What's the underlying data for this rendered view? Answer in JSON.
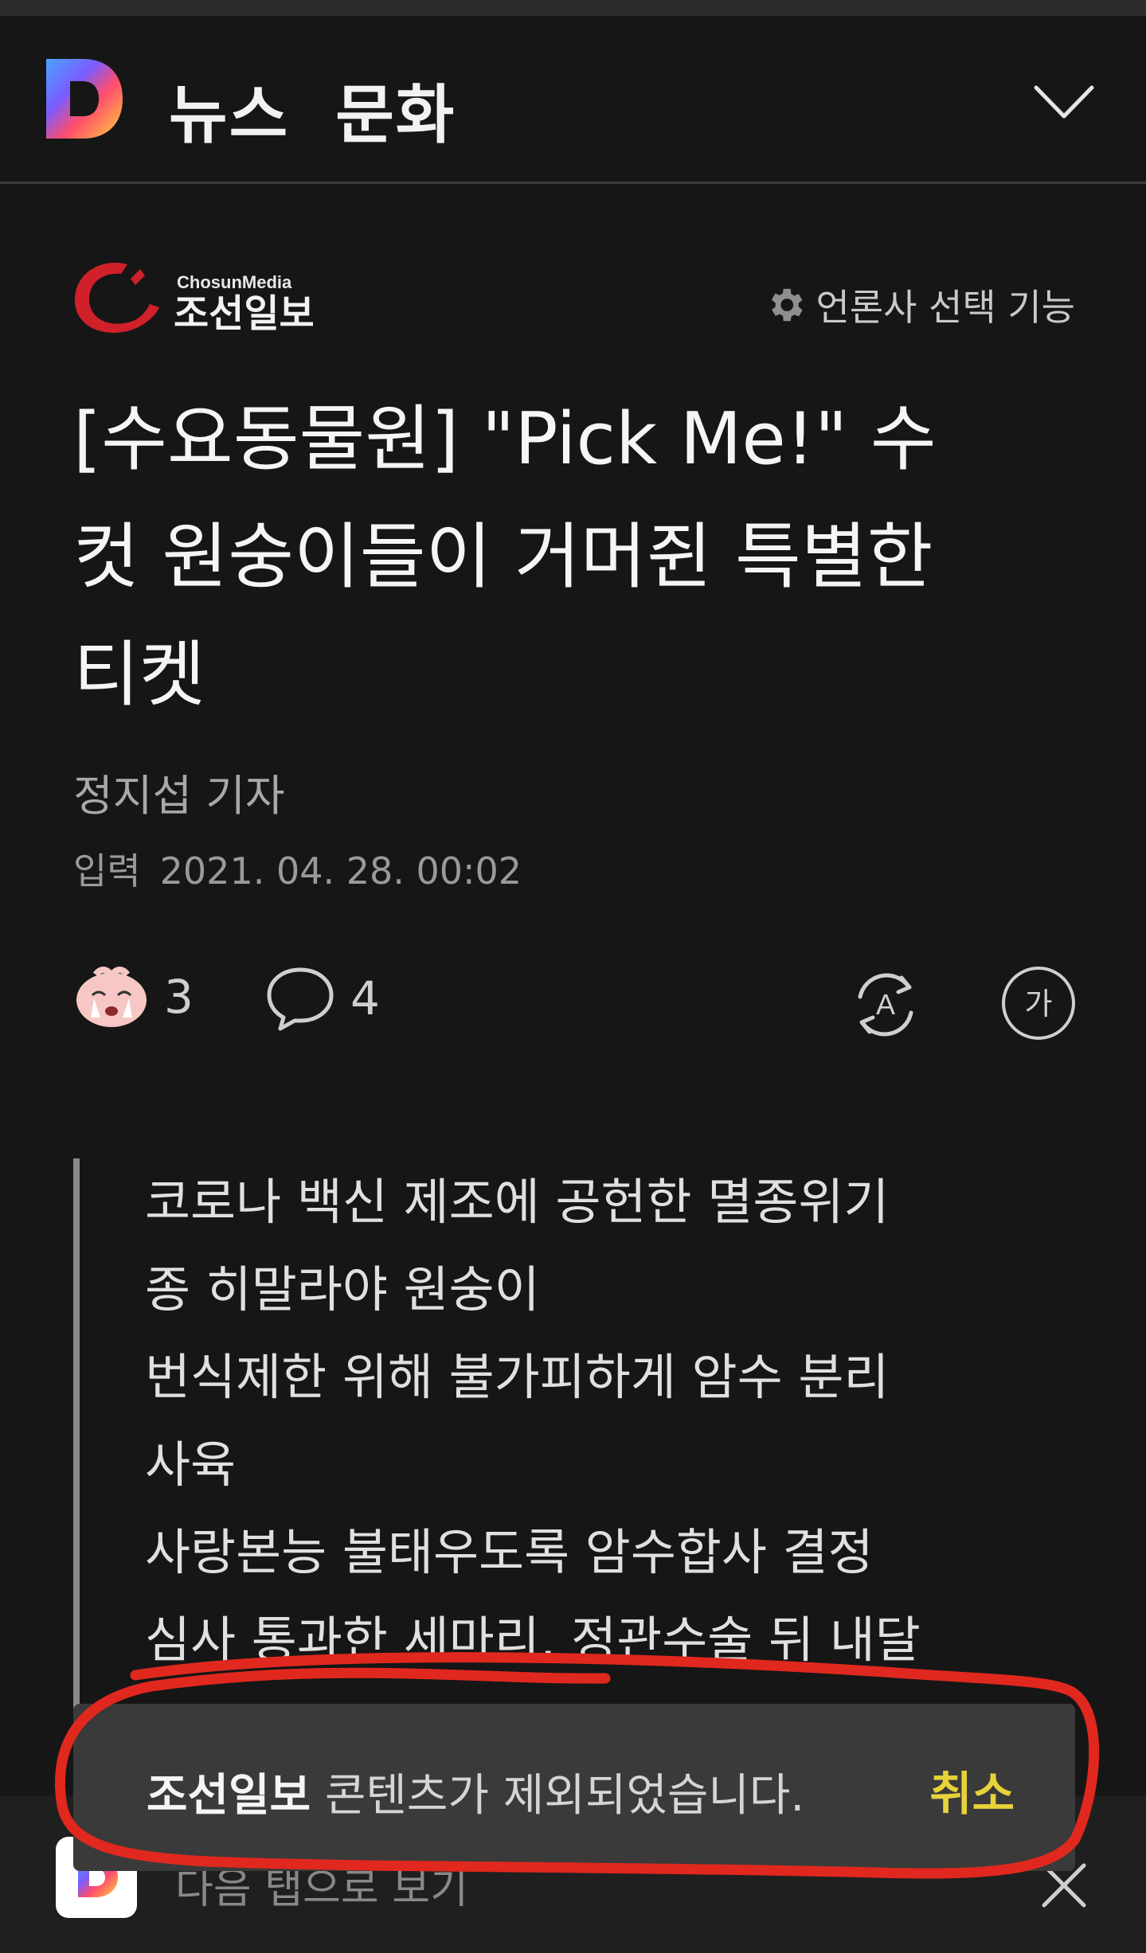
{
  "header": {
    "nav_primary": "뉴스",
    "nav_secondary": "문화"
  },
  "press": {
    "logo_top": "ChosunMedia",
    "logo_name": "조선일보",
    "settings_label": "언론사 선택 기능"
  },
  "article": {
    "title_lines": [
      "[수요동물원] \"Pick Me!\" 수",
      "컷 원숭이들이 거머쥔 특별한",
      "티켓"
    ],
    "reporter": "정지섭 기자",
    "date_label": "입력",
    "date_value": "2021. 04. 28. 00:02"
  },
  "actions": {
    "reaction_count": "3",
    "comment_count": "4"
  },
  "summary": {
    "lines": [
      "코로나 백신 제조에 공헌한 멸종위기",
      "종 히말라야 원숭이",
      "번식제한 위해 불가피하게 암수 분리",
      "사육",
      "사랑본능 불태우도록 암수합사 결정",
      "심사 통과한 세마리, 정관수술 뒤 내달"
    ]
  },
  "toast": {
    "publisher": "조선일보",
    "message": " 콘텐츠가 제외되었습니다.",
    "undo_label": "취소"
  },
  "bottom": {
    "hidden_text": "다음 탭으로 보기"
  },
  "colors": {
    "background": "#161616",
    "toast_bg": "#3a3a3a",
    "undo": "#e8d23a",
    "annotation": "#e0281e",
    "brand_red": "#d0202a"
  }
}
